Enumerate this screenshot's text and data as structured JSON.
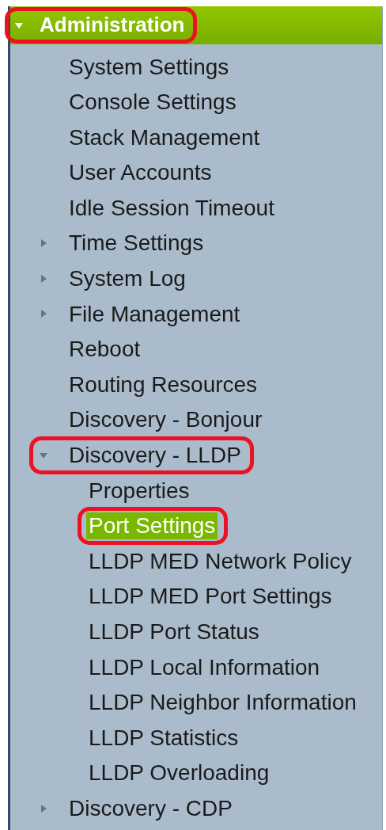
{
  "menu": {
    "label": "Administration",
    "expanded": true,
    "annotated": true,
    "children": [
      {
        "label": "System Settings",
        "selected": false
      },
      {
        "label": "Console Settings",
        "selected": false
      },
      {
        "label": "Stack Management",
        "selected": false
      },
      {
        "label": "User Accounts",
        "selected": false
      },
      {
        "label": "Idle Session Timeout",
        "selected": false
      },
      {
        "label": "Time Settings",
        "selected": false,
        "expanded": false
      },
      {
        "label": "System Log",
        "selected": false,
        "expanded": false
      },
      {
        "label": "File Management",
        "selected": false,
        "expanded": false
      },
      {
        "label": "Reboot",
        "selected": false
      },
      {
        "label": "Routing Resources",
        "selected": false
      },
      {
        "label": "Discovery - Bonjour",
        "selected": false
      },
      {
        "label": "Discovery - LLDP",
        "selected": false,
        "expanded": true,
        "annotated": true,
        "children": [
          {
            "label": "Properties",
            "selected": false
          },
          {
            "label": "Port Settings",
            "selected": true,
            "annotated": true
          },
          {
            "label": "LLDP MED Network Policy",
            "selected": false
          },
          {
            "label": "LLDP MED Port Settings",
            "selected": false
          },
          {
            "label": "LLDP Port Status",
            "selected": false
          },
          {
            "label": "LLDP Local Information",
            "selected": false
          },
          {
            "label": "LLDP Neighbor Information",
            "selected": false
          },
          {
            "label": "LLDP Statistics",
            "selected": false
          },
          {
            "label": "LLDP Overloading",
            "selected": false
          }
        ]
      },
      {
        "label": "Discovery - CDP",
        "selected": false,
        "expanded": false
      }
    ]
  }
}
